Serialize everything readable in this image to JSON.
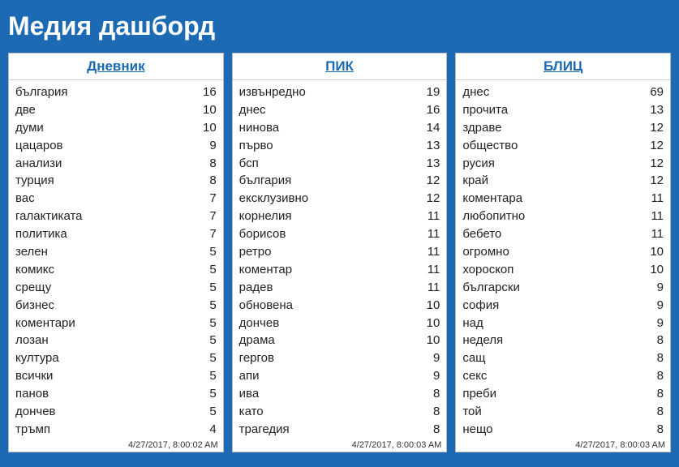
{
  "title": "Медия дашборд",
  "panels": [
    {
      "name": "Дневник",
      "timestamp": "4/27/2017, 8:00:02 AM",
      "rows": [
        {
          "word": "българия",
          "count": 16
        },
        {
          "word": "две",
          "count": 10
        },
        {
          "word": "думи",
          "count": 10
        },
        {
          "word": "цацаров",
          "count": 9
        },
        {
          "word": "анализи",
          "count": 8
        },
        {
          "word": "турция",
          "count": 8
        },
        {
          "word": "вас",
          "count": 7
        },
        {
          "word": "галактиката",
          "count": 7
        },
        {
          "word": "политика",
          "count": 7
        },
        {
          "word": "зелен",
          "count": 5
        },
        {
          "word": "комикс",
          "count": 5
        },
        {
          "word": "срещу",
          "count": 5
        },
        {
          "word": "бизнес",
          "count": 5
        },
        {
          "word": "коментари",
          "count": 5
        },
        {
          "word": "лозан",
          "count": 5
        },
        {
          "word": "култура",
          "count": 5
        },
        {
          "word": "всички",
          "count": 5
        },
        {
          "word": "панов",
          "count": 5
        },
        {
          "word": "дончев",
          "count": 5
        },
        {
          "word": "тръмп",
          "count": 4
        }
      ]
    },
    {
      "name": "ПИК",
      "timestamp": "4/27/2017, 8:00:03 AM",
      "rows": [
        {
          "word": "извънредно",
          "count": 19
        },
        {
          "word": "днес",
          "count": 16
        },
        {
          "word": "нинова",
          "count": 14
        },
        {
          "word": "първо",
          "count": 13
        },
        {
          "word": "бсп",
          "count": 13
        },
        {
          "word": "българия",
          "count": 12
        },
        {
          "word": "ексклузивно",
          "count": 12
        },
        {
          "word": "корнелия",
          "count": 11
        },
        {
          "word": "борисов",
          "count": 11
        },
        {
          "word": "ретро",
          "count": 11
        },
        {
          "word": "коментар",
          "count": 11
        },
        {
          "word": "радев",
          "count": 11
        },
        {
          "word": "обновена",
          "count": 10
        },
        {
          "word": "дончев",
          "count": 10
        },
        {
          "word": "драма",
          "count": 10
        },
        {
          "word": "гергов",
          "count": 9
        },
        {
          "word": "апи",
          "count": 9
        },
        {
          "word": "ива",
          "count": 8
        },
        {
          "word": "като",
          "count": 8
        },
        {
          "word": "трагедия",
          "count": 8
        }
      ]
    },
    {
      "name": "БЛИЦ",
      "timestamp": "4/27/2017, 8:00:03 AM",
      "rows": [
        {
          "word": "днес",
          "count": 69
        },
        {
          "word": "прочита",
          "count": 13
        },
        {
          "word": "здраве",
          "count": 12
        },
        {
          "word": "общество",
          "count": 12
        },
        {
          "word": "русия",
          "count": 12
        },
        {
          "word": "край",
          "count": 12
        },
        {
          "word": "коментара",
          "count": 11
        },
        {
          "word": "любопитно",
          "count": 11
        },
        {
          "word": "бебето",
          "count": 11
        },
        {
          "word": "огромно",
          "count": 10
        },
        {
          "word": "хороскоп",
          "count": 10
        },
        {
          "word": "български",
          "count": 9
        },
        {
          "word": "софия",
          "count": 9
        },
        {
          "word": "над",
          "count": 9
        },
        {
          "word": "неделя",
          "count": 8
        },
        {
          "word": "сащ",
          "count": 8
        },
        {
          "word": "секс",
          "count": 8
        },
        {
          "word": "преби",
          "count": 8
        },
        {
          "word": "той",
          "count": 8
        },
        {
          "word": "нещо",
          "count": 8
        }
      ]
    }
  ]
}
